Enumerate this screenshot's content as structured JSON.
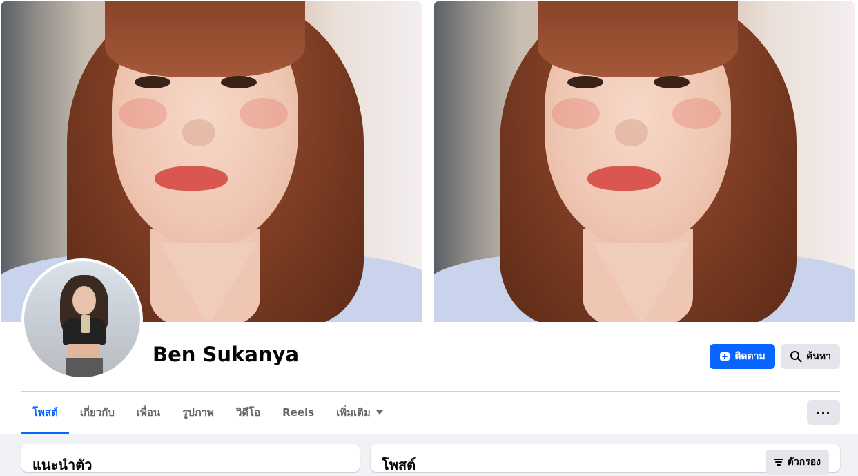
{
  "profile": {
    "name": "Ben Sukanya"
  },
  "actions": {
    "follow_label": "ติดตาม",
    "search_label": "ค้นหา",
    "more_label": "···"
  },
  "tabs": [
    {
      "label": "โพสต์",
      "active": true
    },
    {
      "label": "เกี่ยวกับ"
    },
    {
      "label": "เพื่อน"
    },
    {
      "label": "รูปภาพ"
    },
    {
      "label": "วิดีโอ"
    },
    {
      "label": "Reels"
    },
    {
      "label": "เพิ่มเติม"
    }
  ],
  "intro_card": {
    "title": "แนะนำตัว"
  },
  "posts_card": {
    "title": "โพสต์",
    "filter_label": "ตัวกรอง"
  },
  "colors": {
    "accent": "#0866ff",
    "button_gray": "#e4e6eb",
    "background": "#f0f2f5",
    "text_primary": "#050505",
    "text_secondary": "#65676b"
  },
  "icons": {
    "follow": "add-friend-icon",
    "search": "search-icon",
    "more_tab": "caret-down-icon",
    "filter": "filter-icon"
  }
}
